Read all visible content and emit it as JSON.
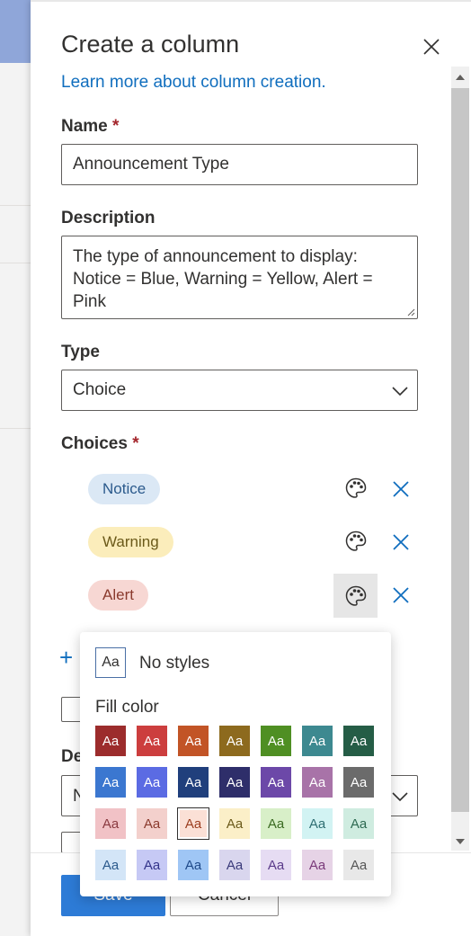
{
  "panel": {
    "title": "Create a column",
    "learn_link": "Learn more about column creation."
  },
  "name": {
    "label": "Name",
    "required": "*",
    "value": "Announcement Type"
  },
  "description": {
    "label": "Description",
    "value": "The type of announcement to display: Notice = Blue, Warning = Yellow, Alert = Pink"
  },
  "type": {
    "label": "Type",
    "value": "Choice"
  },
  "choices": {
    "label": "Choices",
    "required": "*",
    "items": [
      {
        "label": "Notice",
        "bg": "#dbe8f5",
        "fg": "#2b5a8c"
      },
      {
        "label": "Warning",
        "bg": "#fbedbb",
        "fg": "#6b5a1a"
      },
      {
        "label": "Alert",
        "bg": "#f7d7d3",
        "fg": "#8a3a2d"
      }
    ]
  },
  "hidden_label_prefix": "De",
  "hidden_value_prefix": "N",
  "footer": {
    "save": "Save",
    "cancel": "Cancel"
  },
  "color_popup": {
    "no_styles_sample": "Aa",
    "no_styles_label": "No styles",
    "fill_label": "Fill color",
    "swatch_text": "Aa",
    "rows": [
      [
        {
          "bg": "#9c2c2c",
          "fg": "#ffffff"
        },
        {
          "bg": "#cc3e3e",
          "fg": "#ffffff"
        },
        {
          "bg": "#c25426",
          "fg": "#ffffff"
        },
        {
          "bg": "#8d6a1e",
          "fg": "#ffffff"
        },
        {
          "bg": "#4f8f23",
          "fg": "#ffffff"
        },
        {
          "bg": "#3d8990",
          "fg": "#ffffff"
        },
        {
          "bg": "#255d46",
          "fg": "#ffffff"
        }
      ],
      [
        {
          "bg": "#3b77d0",
          "fg": "#ffffff"
        },
        {
          "bg": "#5b6be3",
          "fg": "#ffffff"
        },
        {
          "bg": "#203f7c",
          "fg": "#ffffff"
        },
        {
          "bg": "#2e2e6a",
          "fg": "#ffffff"
        },
        {
          "bg": "#6c48a8",
          "fg": "#ffffff"
        },
        {
          "bg": "#a873a8",
          "fg": "#ffffff"
        },
        {
          "bg": "#6b6b6b",
          "fg": "#ffffff"
        }
      ],
      [
        {
          "bg": "#f1c2c6",
          "fg": "#8a3a40"
        },
        {
          "bg": "#f3d0cc",
          "fg": "#8a3a2d"
        },
        {
          "bg": "#fbe0d6",
          "fg": "#9c3d1f",
          "selected": true
        },
        {
          "bg": "#fbefc8",
          "fg": "#6b5a1a"
        },
        {
          "bg": "#d8efc8",
          "fg": "#3b6b22"
        },
        {
          "bg": "#d2f3f3",
          "fg": "#2f6f73"
        },
        {
          "bg": "#cfece0",
          "fg": "#2e6a52"
        }
      ],
      [
        {
          "bg": "#d3e5f7",
          "fg": "#2b5a8c"
        },
        {
          "bg": "#c6c9f5",
          "fg": "#33338a"
        },
        {
          "bg": "#9fc6f5",
          "fg": "#1f4a8a"
        },
        {
          "bg": "#d9d6ee",
          "fg": "#3a3a7a"
        },
        {
          "bg": "#e6dcf3",
          "fg": "#5a3a8a"
        },
        {
          "bg": "#e6d3e6",
          "fg": "#7a3a7a"
        },
        {
          "bg": "#e8e8e8",
          "fg": "#555555"
        }
      ]
    ]
  }
}
